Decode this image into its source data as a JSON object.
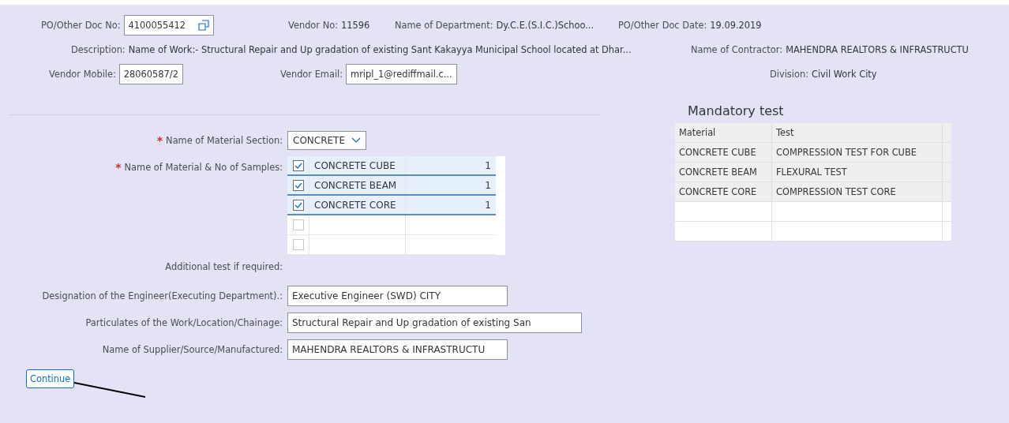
{
  "header": {
    "rows": [
      {
        "items": [
          {
            "label": "PO/Other Doc No:",
            "kind": "field",
            "value": "4100055412",
            "copy": true
          },
          {
            "label": "Vendor No:",
            "kind": "text",
            "value": "11596"
          },
          {
            "label": "Name of Department:",
            "kind": "text",
            "value": "Dy.C.E.(S.I.C.)Schoo..."
          },
          {
            "label": "PO/Other Doc Date:",
            "kind": "text",
            "value": "19.09.2019"
          }
        ]
      },
      {
        "items": [
          {
            "label": "Description:",
            "kind": "text",
            "value": "Name of Work:- Structural Repair and Up gradation of existing Sant Kakayya Municipal School located at Dhar..."
          },
          {
            "label": "Name of Contractor:",
            "kind": "text",
            "value": "MAHENDRA REALTORS & INFRASTRUCTU"
          }
        ]
      },
      {
        "items": [
          {
            "label": "Vendor Mobile:",
            "kind": "field",
            "value": "28060587/2",
            "copy": false
          },
          {
            "label": "Vendor Email:",
            "kind": "field",
            "value": "mripl_1@rediffmail.c...",
            "copy": false
          },
          {
            "label": "Division:",
            "kind": "text",
            "value": "Civil Work City"
          }
        ]
      }
    ]
  },
  "form": {
    "material_section": {
      "required_mark": "*",
      "label": "Name of Material Section:",
      "value": "CONCRETE"
    },
    "samples": {
      "required_mark": "*",
      "label": "Name of Material & No of Samples:",
      "rows": [
        {
          "checked": true,
          "material": "CONCRETE CUBE",
          "count": "1"
        },
        {
          "checked": true,
          "material": "CONCRETE BEAM",
          "count": "1"
        },
        {
          "checked": true,
          "material": "CONCRETE CORE",
          "count": "1"
        },
        {
          "checked": false
        },
        {
          "checked": false
        }
      ]
    },
    "additional_label": "Additional test if required:",
    "fields": [
      {
        "label": "Designation of the Engineer(Executing Department).:",
        "value": "Executive Engineer (SWD) CITY"
      },
      {
        "label": "Particulates of the Work/Location/Chainage:",
        "value": "Structural Repair and Up gradation of existing San"
      },
      {
        "label": "Name of Supplier/Source/Manufactured:",
        "value": "MAHENDRA REALTORS & INFRASTRUCTU"
      }
    ],
    "continue_button": "Continue"
  },
  "mandatory_test": {
    "title": "Mandatory test",
    "columns": [
      "Material",
      "Test"
    ],
    "rows": [
      [
        "CONCRETE CUBE",
        "COMPRESSION TEST FOR CUBE"
      ],
      [
        "CONCRETE BEAM",
        "FLEXURAL TEST"
      ],
      [
        "CONCRETE CORE",
        "COMPRESSION TEST CORE"
      ],
      [
        "",
        ""
      ],
      [
        "",
        ""
      ]
    ]
  }
}
